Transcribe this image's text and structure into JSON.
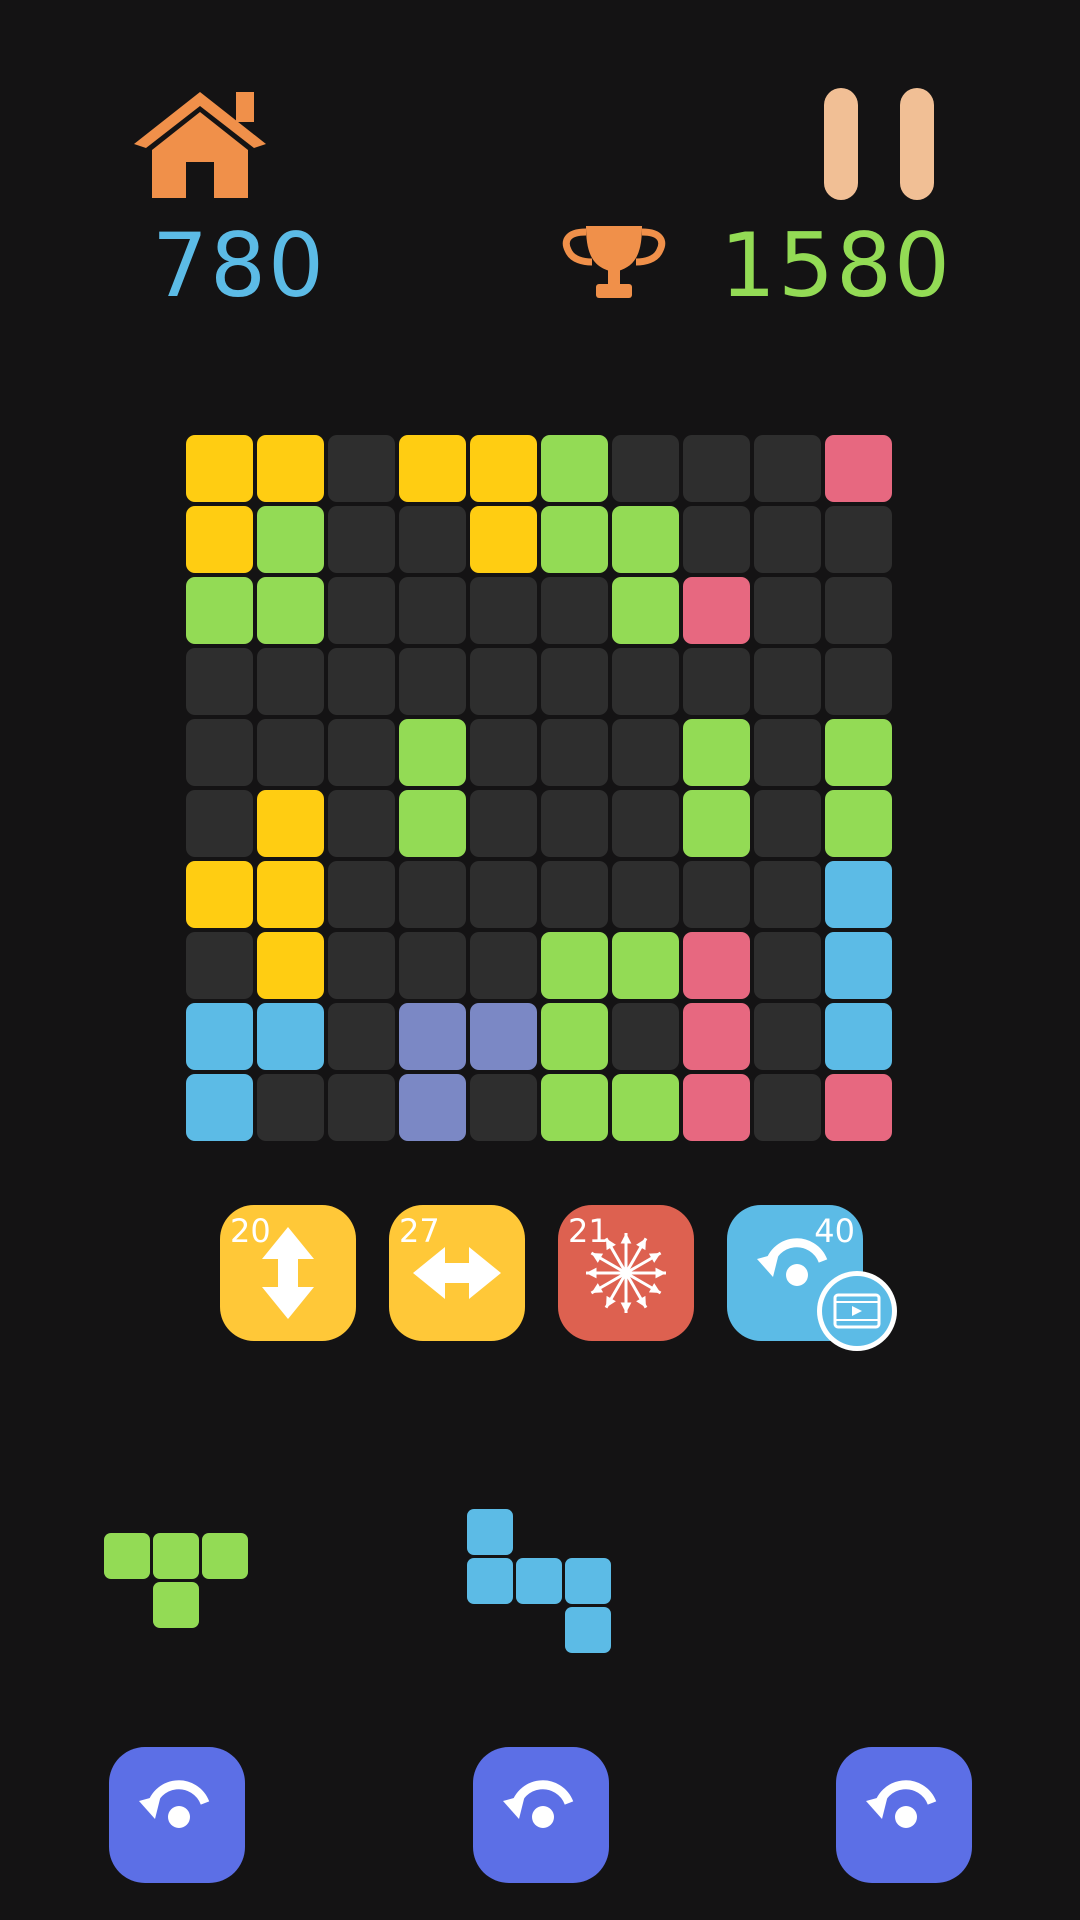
{
  "score": {
    "current": "780",
    "best": "1580"
  },
  "colors": {
    "empty": "#2e2e2e",
    "Y": "#ffcd12",
    "G": "#93db55",
    "R": "#e76880",
    "B": "#5cbbe6",
    "P": "#7b88c5",
    "score_current": "#5cbbe6",
    "score_best": "#93db55",
    "home_icon": "#f0904a",
    "trophy_icon": "#f0904a",
    "pause_icon": "#f1bf95",
    "rotate_button": "#5c6fe6"
  },
  "board": {
    "size": 10,
    "rows": [
      "YY.YYG...R",
      "YG..YGG...",
      "GG....GR..",
      "..........",
      "...G...G.G",
      ".Y.G...G.G",
      "YY.......B",
      ".Y...GGR.B",
      "BB.PPG.R.B",
      "B..P.GGR.R"
    ]
  },
  "powerups": [
    {
      "id": "vertical",
      "icon": "vertical-arrow-icon",
      "count": "20",
      "color": "#ffc838"
    },
    {
      "id": "horizontal",
      "icon": "horizontal-arrow-icon",
      "count": "27",
      "color": "#ffc838"
    },
    {
      "id": "bomb",
      "icon": "burst-icon",
      "count": "21",
      "color": "#dd6150"
    },
    {
      "id": "rotate",
      "icon": "rotate-icon",
      "count": "40",
      "color": "#5cbbe6",
      "badge_icon": "video-ad-icon"
    }
  ],
  "pieces": [
    {
      "color": "G",
      "cells": [
        [
          0,
          0
        ],
        [
          1,
          0
        ],
        [
          2,
          0
        ],
        [
          1,
          1
        ]
      ]
    },
    {
      "color": "B",
      "cells": [
        [
          0,
          0
        ],
        [
          0,
          1
        ],
        [
          1,
          1
        ],
        [
          2,
          1
        ],
        [
          2,
          2
        ]
      ]
    }
  ],
  "rotate_buttons": [
    {
      "icon": "rotate-icon"
    },
    {
      "icon": "rotate-icon"
    },
    {
      "icon": "rotate-icon"
    }
  ]
}
